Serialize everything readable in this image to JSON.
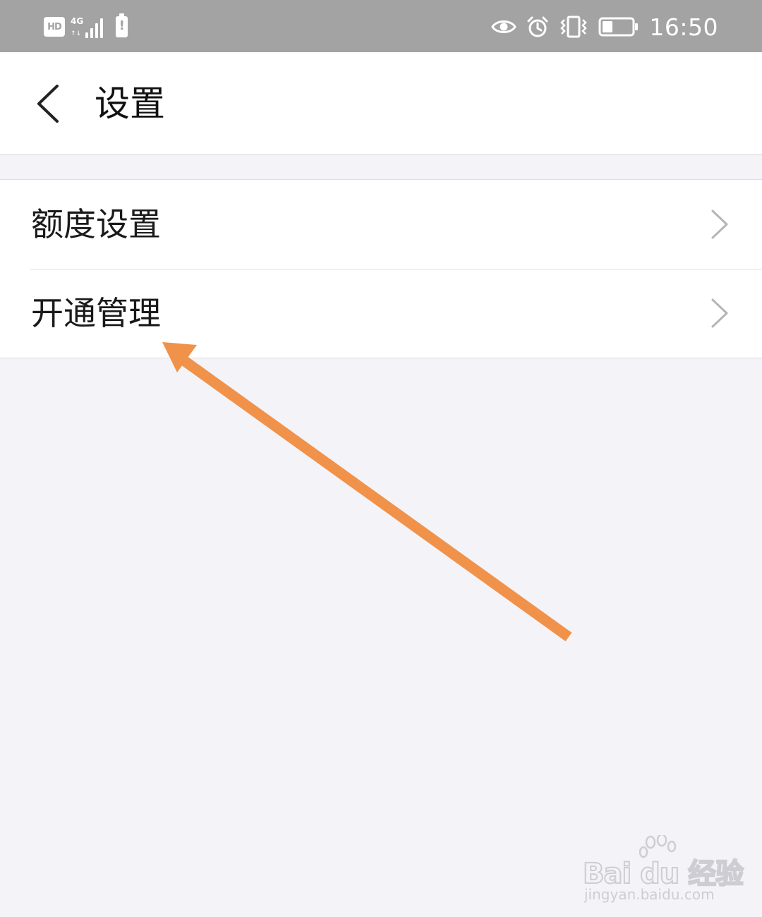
{
  "status_bar": {
    "hd_badge": "HD",
    "network": "4G",
    "network_arrows": "↑↓",
    "time": "16:50",
    "icons": [
      "hd-icon",
      "signal-icon",
      "notification-alert-icon",
      "eye-icon",
      "alarm-clock-icon",
      "vibrate-icon",
      "battery-icon"
    ],
    "battery_level": 0.35
  },
  "header": {
    "back_icon": "chevron-left-icon",
    "title": "设置"
  },
  "settings_list": {
    "items": [
      {
        "label": "额度设置",
        "icon": "chevron-right-icon"
      },
      {
        "label": "开通管理",
        "icon": "chevron-right-icon"
      }
    ]
  },
  "annotation": {
    "type": "arrow",
    "color": "#f0924a",
    "points_to": "开通管理"
  },
  "watermark": {
    "brand": "Bai du 经验",
    "url": "jingyan.baidu.com"
  },
  "colors": {
    "status_bar_bg": "#a3a3a3",
    "page_bg": "#f3f3f8",
    "card_bg": "#ffffff",
    "text": "#111111",
    "chevron": "#b5b5b5",
    "arrow": "#f0924a"
  }
}
